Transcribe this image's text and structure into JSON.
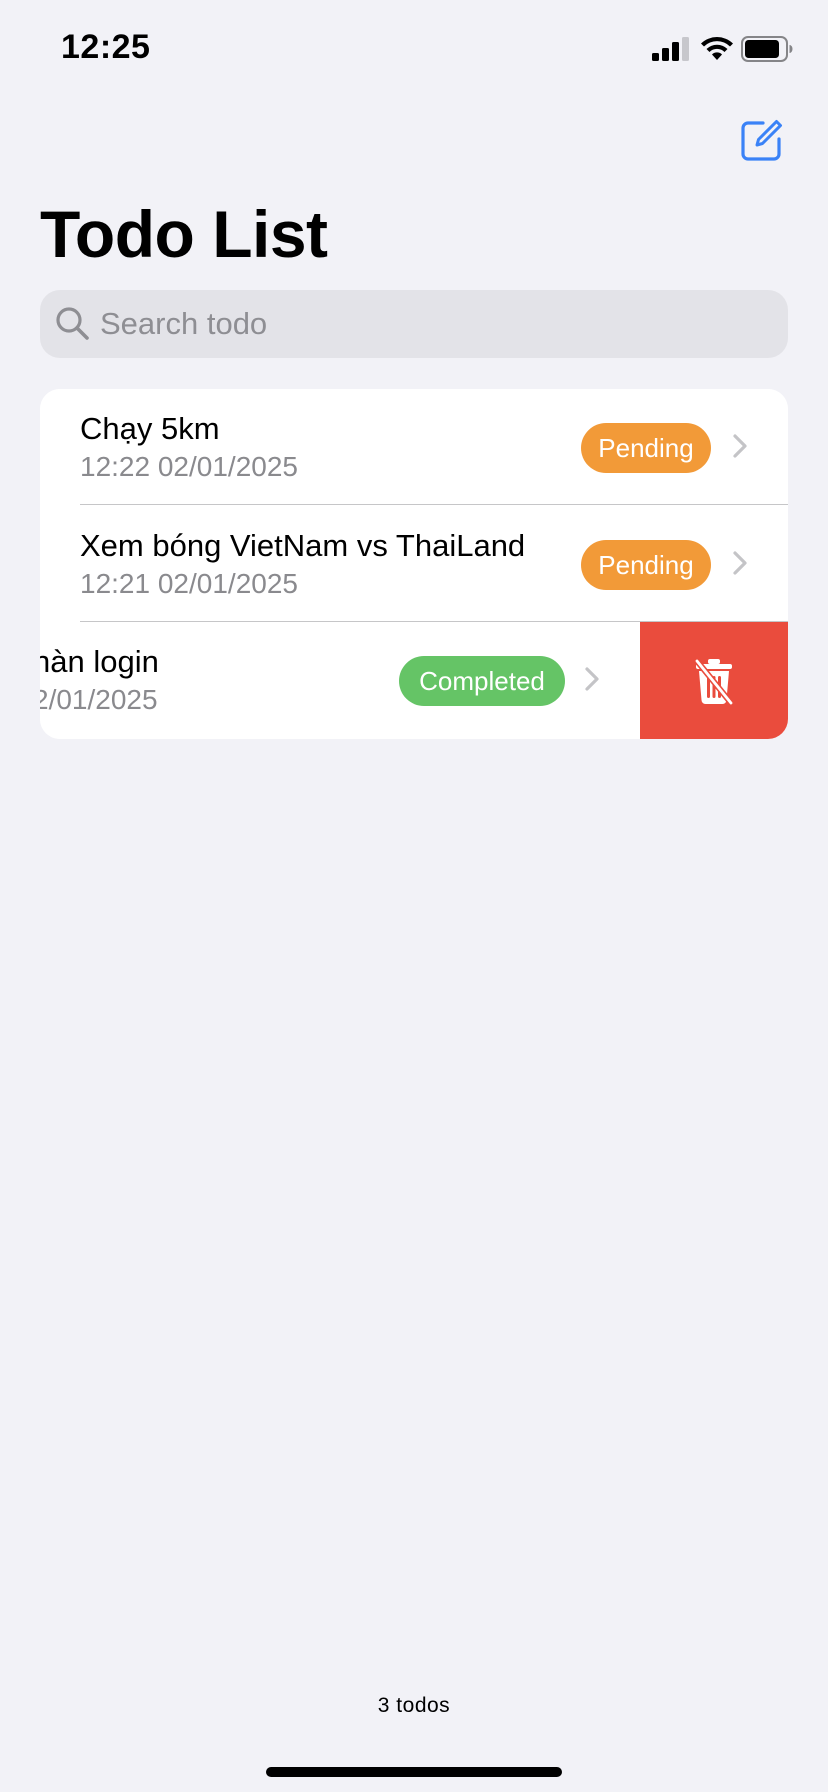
{
  "status_bar": {
    "time": "12:25"
  },
  "header": {
    "title": "Todo List",
    "compose_icon": "square-pencil-icon"
  },
  "search": {
    "placeholder": "Search todo",
    "value": ""
  },
  "todos": [
    {
      "title": "Chạy 5km",
      "date": "12:22 02/01/2025",
      "status": "Pending"
    },
    {
      "title": "Xem bóng VietNam vs ThaiLand",
      "date": "12:21 02/01/2025",
      "status": "Pending"
    },
    {
      "title": "hàn login",
      "date": "2/01/2025",
      "status": "Completed"
    }
  ],
  "swipe_action": {
    "icon": "trash-icon"
  },
  "footer": {
    "count": "3 todos"
  },
  "colors": {
    "background": "#f2f2f7",
    "accent": "#3a82f7",
    "pending": "#f29a38",
    "completed": "#65c466",
    "destructive": "#ea4c3d",
    "secondary_text": "#8a8a8e"
  }
}
